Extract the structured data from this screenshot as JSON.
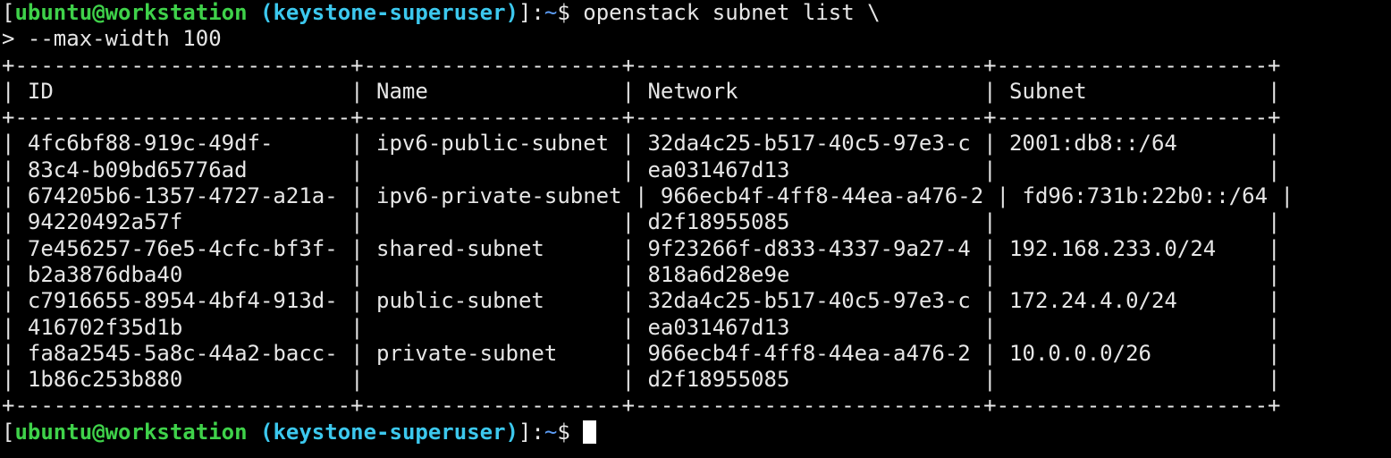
{
  "prompt": {
    "open_bracket": "[",
    "user_host": "ubuntu@workstation",
    "space": " ",
    "venv": "(keystone-superuser)",
    "close_bracket": "]:",
    "cwd": "~",
    "dollar": "$ "
  },
  "command": {
    "line1": "openstack subnet list \\",
    "line2": "> --max-width 100"
  },
  "table": {
    "border_top": "+--------------------------+--------------------+---------------------------+---------------------+",
    "header": "| ID                       | Name               | Network                   | Subnet              |",
    "border_mid": "+--------------------------+--------------------+---------------------------+---------------------+",
    "rows": [
      "| 4fc6bf88-919c-49df-      | ipv6-public-subnet | 32da4c25-b517-40c5-97e3-c | 2001:db8::/64       |",
      "| 83c4-b09bd65776ad        |                    | ea031467d13               |                     |",
      "| 674205b6-1357-4727-a21a- | ipv6-private-subnet | 966ecb4f-4ff8-44ea-a476-2 | fd96:731b:22b0::/64 |",
      "| 94220492a57f             |                    | d2f18955085               |                     |",
      "| 7e456257-76e5-4cfc-bf3f- | shared-subnet      | 9f23266f-d833-4337-9a27-4 | 192.168.233.0/24    |",
      "| b2a3876dba40             |                    | 818a6d28e9e               |                     |",
      "| c7916655-8954-4bf4-913d- | public-subnet      | 32da4c25-b517-40c5-97e3-c | 172.24.4.0/24       |",
      "| 416702f35d1b             |                    | ea031467d13               |                     |",
      "| fa8a2545-5a8c-44a2-bacc- | private-subnet     | 966ecb4f-4ff8-44ea-a476-2 | 10.0.0.0/26         |",
      "| 1b86c253b880             |                    | d2f18955085               |                     |"
    ],
    "border_bottom": "+--------------------------+--------------------+---------------------------+---------------------+"
  },
  "colors": {
    "background": "#000000",
    "text": "#e6e6e6",
    "user_host": "#3fd24a",
    "venv": "#3cc8ee",
    "cwd": "#5c9cf5"
  }
}
